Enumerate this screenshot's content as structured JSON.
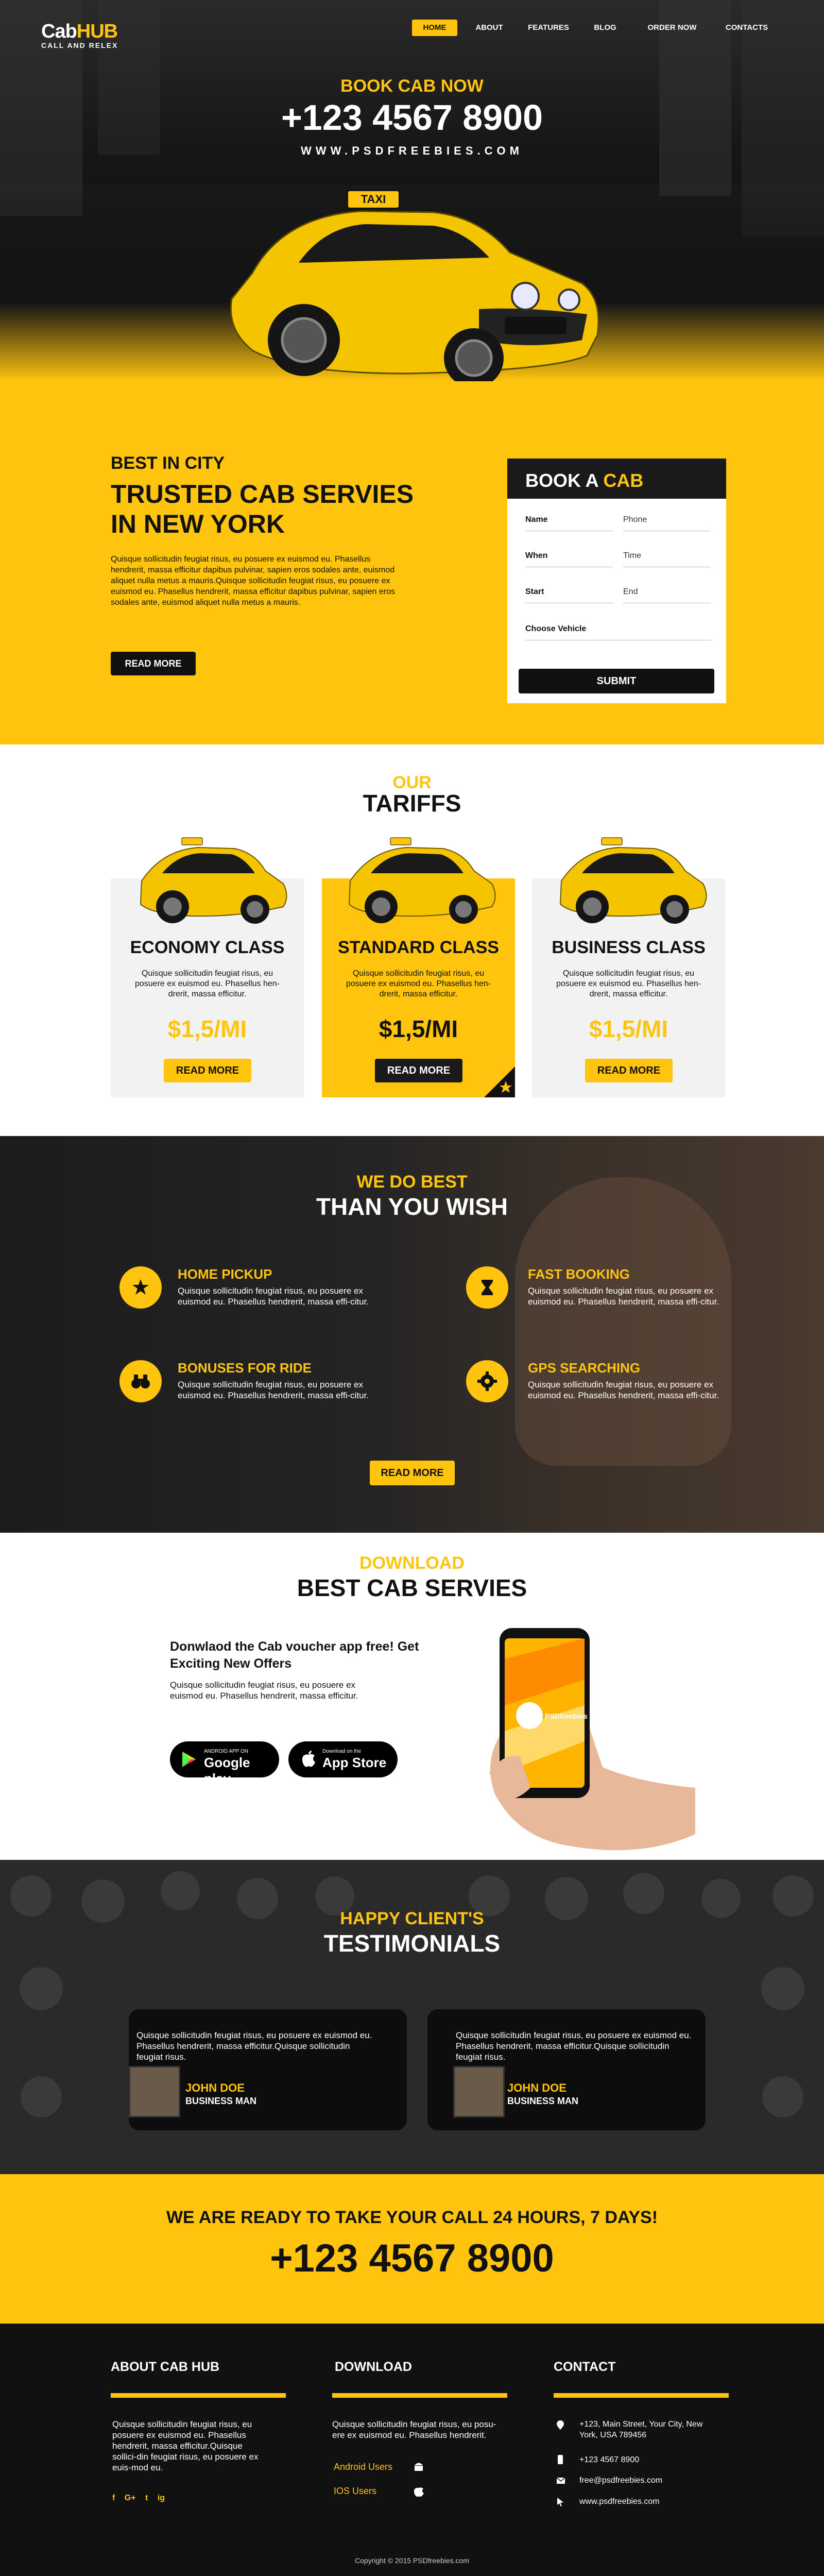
{
  "header": {
    "logo_main": "Cab",
    "logo_accent": "HUB",
    "logo_sub": "CALL AND RELEX",
    "nav": [
      "HOME",
      "ABOUT",
      "FEATURES",
      "BLOG",
      "ORDER NOW",
      "CONTACTS"
    ],
    "active_nav": "HOME"
  },
  "hero": {
    "book_label": "BOOK CAB NOW",
    "phone": "+123 4567 8900",
    "website": "WWW.PSDFREEBIES.COM",
    "taxi_sign": "TAXI"
  },
  "intro": {
    "kicker": "BEST IN CITY",
    "title": "TRUSTED CAB SERVIES IN NEW YORK",
    "body": "Quisque sollicitudin feugiat risus, eu posuere ex euismod eu. Phasellus hendrerit, massa efficitur dapibus pulvinar, sapien eros sodales ante, euismod aliquet nulla metus a mauris.Quisque sollicitudin feugiat risus, eu posuere ex euismod eu. Phasellus hendrerit, massa efficitur dapibus pulvinar, sapien eros sodales ante, euismod aliquet nulla metus a mauris.",
    "read_more": "READ MORE"
  },
  "book_form": {
    "title_a": "BOOK A",
    "title_b": "CAB",
    "fields": {
      "name": "Name",
      "phone": "Phone",
      "when": "When",
      "time": "Time",
      "start": "Start",
      "end": "End",
      "vehicle": "Choose Vehicle"
    },
    "submit": "SUBMIT"
  },
  "tariffs": {
    "kicker": "OUR",
    "title": "TARIFFS",
    "cards": [
      {
        "title": "ECONOMY CLASS",
        "desc": "Quisque sollicitudin feugiat risus, eu posuere ex euismod eu. Phasellus hen-drerit, massa efficitur.",
        "price": "$1,5/MI",
        "button": "READ MORE"
      },
      {
        "title": "STANDARD CLASS",
        "desc": "Quisque sollicitudin feugiat risus, eu posuere ex euismod eu. Phasellus hen-drerit, massa efficitur.",
        "price": "$1,5/MI",
        "button": "READ MORE"
      },
      {
        "title": "BUSINESS CLASS",
        "desc": "Quisque sollicitudin feugiat risus, eu posuere ex euismod eu. Phasellus hen-drerit, massa efficitur.",
        "price": "$1,5/MI",
        "button": "READ MORE"
      }
    ]
  },
  "best": {
    "kicker": "WE DO BEST",
    "title": "THAN YOU WISH",
    "features": [
      {
        "title": "HOME PICKUP",
        "icon": "star-icon",
        "desc": "Quisque sollicitudin feugiat risus, eu posuere ex euismod eu. Phasellus hendrerit, massa effi-citur."
      },
      {
        "title": "FAST BOOKING",
        "icon": "hourglass-icon",
        "desc": "Quisque sollicitudin feugiat risus, eu posuere ex euismod eu. Phasellus hendrerit, massa effi-citur."
      },
      {
        "title": "BONUSES FOR RIDE",
        "icon": "binoculars-icon",
        "desc": "Quisque sollicitudin feugiat risus, eu posuere ex euismod eu. Phasellus hendrerit, massa effi-citur."
      },
      {
        "title": "GPS SEARCHING",
        "icon": "gear-icon",
        "desc": "Quisque sollicitudin feugiat risus, eu posuere ex euismod eu. Phasellus hendrerit, massa effi-citur."
      }
    ],
    "read_more": "READ MORE"
  },
  "download": {
    "kicker": "DOWNLOAD",
    "title": "BEST CAB SERVIES",
    "heading": "Donwlaod the Cab voucher app free! Get Exciting New Offers",
    "body": "Quisque sollicitudin feugiat risus, eu posuere ex euismod eu. Phasellus hendrerit, massa efficitur.",
    "google_small": "ANDROID APP ON",
    "google_big": "Google play",
    "apple_small": "Download on the",
    "apple_big": "App Store",
    "phone_brand": "PSDfreebies"
  },
  "testimonials": {
    "kicker": "HAPPY CLIENT'S",
    "title": "TESTIMONIALS",
    "items": [
      {
        "quote": "Quisque sollicitudin feugiat risus, eu posuere ex euismod eu. Phasellus hendrerit, massa efficitur.Quisque sollicitudin feugiat risus.",
        "name": "JOHN DOE",
        "role": "BUSINESS MAN"
      },
      {
        "quote": "Quisque sollicitudin feugiat risus, eu posuere ex euismod eu. Phasellus hendrerit, massa efficitur.Quisque sollicitudin feugiat risus.",
        "name": "JOHN DOE",
        "role": "BUSINESS MAN"
      }
    ]
  },
  "cta": {
    "line": "WE ARE READY TO TAKE YOUR CALL 24 HOURS, 7 DAYS!",
    "phone": "+123 4567 8900"
  },
  "footer": {
    "about_title": "ABOUT CAB HUB",
    "about_body": "Quisque sollicitudin feugiat risus, eu posuere ex euismod eu. Phasellus hendrerit, massa efficitur.Quisque sollici-din feugiat risus, eu posuere ex euis-mod eu.",
    "social": [
      "f",
      "G+",
      "t",
      "ig"
    ],
    "download_title": "DOWNLOAD",
    "download_body": "Quisque sollicitudin feugiat risus, eu posu-ere ex euismod eu. Phasellus hendrerit.",
    "android_link": "Android Users",
    "ios_link": "IOS Users",
    "contact_title": "CONTACT",
    "address": "+123, Main Street, Your City, New York, USA 789456",
    "phone": "+123 4567 8900",
    "email": "free@psdfreebies.com",
    "website": "www.psdfreebies.com",
    "copyright": "Copyright © 2015 PSDfreebies.com"
  },
  "colors": {
    "accent": "#ffc40e",
    "dark": "#111111",
    "card": "#f2f2f2"
  }
}
